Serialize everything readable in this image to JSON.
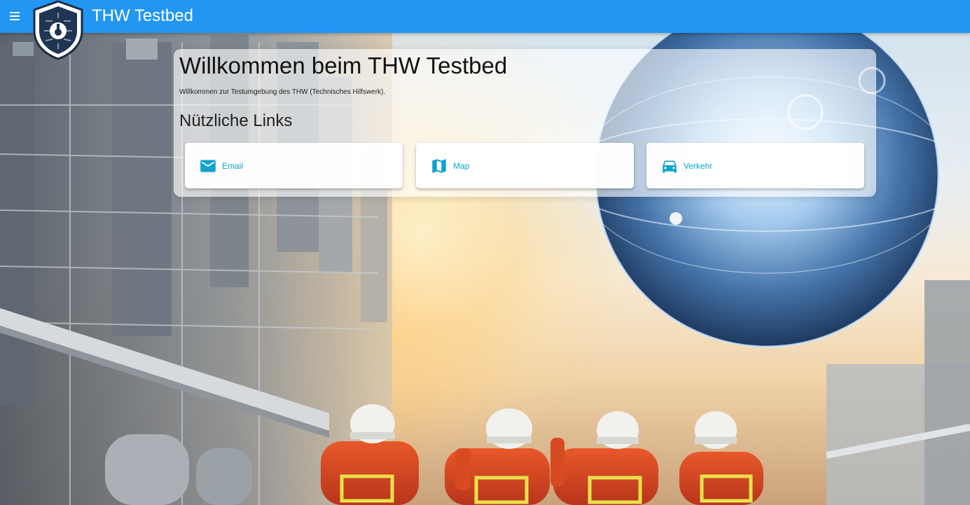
{
  "app": {
    "title": "THW Testbed"
  },
  "welcome": {
    "heading": "Willkommen beim THW Testbed",
    "description": "Willkommen zur Testumgebung des THW (Technisches Hilfswerk).",
    "links_heading": "Nützliche Links"
  },
  "links": [
    {
      "label": "Email",
      "icon": "email-icon"
    },
    {
      "label": "Map",
      "icon": "map-icon"
    },
    {
      "label": "Verkehr",
      "icon": "car-icon"
    }
  ],
  "colors": {
    "appbar": "#2196f3",
    "link_accent": "#0fa3c9"
  }
}
